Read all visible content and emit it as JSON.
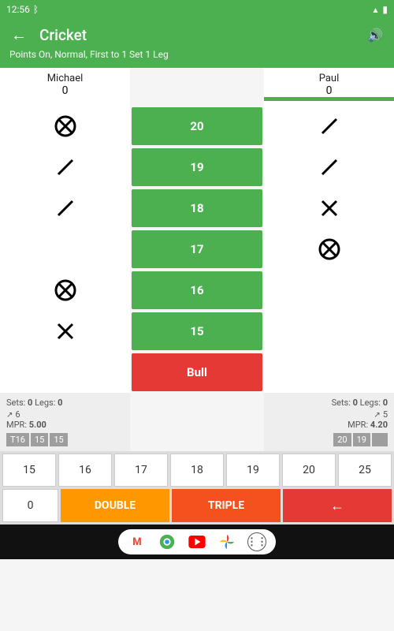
{
  "status": {
    "time": "12:56"
  },
  "appbar": {
    "title": "Cricket",
    "subtitle": "Points On, Normal, First to 1 Set 1 Leg"
  },
  "players": {
    "left": {
      "name": "Michael",
      "score": "0",
      "active": false,
      "marks": [
        "circle-x",
        "slash",
        "slash",
        "",
        "circle-x",
        "x",
        ""
      ],
      "sets_label": "Sets:",
      "sets": "0",
      "legs_label": "Legs:",
      "legs": "0",
      "darts": "6",
      "mpr_label": "MPR:",
      "mpr": "5.00",
      "hist": [
        "T16",
        "15",
        "15"
      ]
    },
    "right": {
      "name": "Paul",
      "score": "0",
      "active": true,
      "marks": [
        "slash",
        "slash",
        "x",
        "circle-x",
        "",
        "",
        ""
      ],
      "sets_label": "Sets:",
      "sets": "0",
      "legs_label": "Legs:",
      "legs": "0",
      "darts": "5",
      "mpr_label": "MPR:",
      "mpr": "4.20",
      "hist": [
        "20",
        "19",
        ""
      ]
    }
  },
  "targets": [
    "20",
    "19",
    "18",
    "17",
    "16",
    "15",
    "Bull"
  ],
  "keypad": {
    "row1": [
      "15",
      "16",
      "17",
      "18",
      "19",
      "20",
      "25"
    ],
    "zero": "0",
    "double": "DOUBLE",
    "triple": "TRIPLE"
  }
}
